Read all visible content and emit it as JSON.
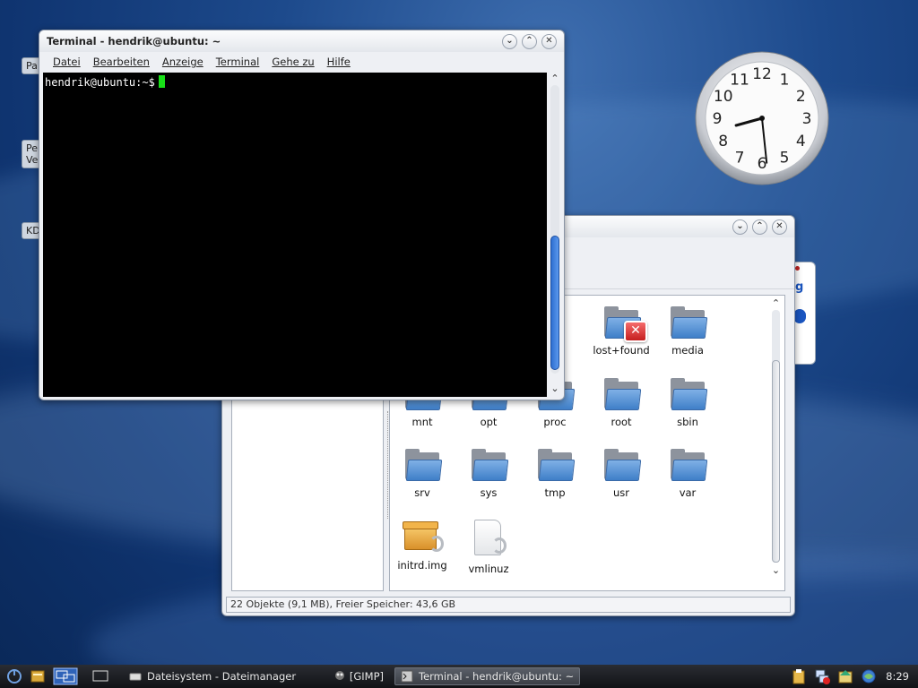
{
  "desktop": {
    "icon_labels": [
      "Pa",
      "Per\nVer",
      "KD"
    ],
    "clock_widget": {
      "hour": 8,
      "minute": 29,
      "numerals": [
        "12",
        "1",
        "2",
        "3",
        "4",
        "5",
        "6",
        "7",
        "8",
        "9",
        "10",
        "11"
      ]
    }
  },
  "terminal": {
    "title": "Terminal - hendrik@ubuntu: ~",
    "menu": [
      "Datei",
      "Bearbeiten",
      "Anzeige",
      "Terminal",
      "Gehe zu",
      "Hilfe"
    ],
    "prompt": "hendrik@ubuntu:~$"
  },
  "file_manager": {
    "status": "22 Objekte (9,1 MB), Freier Speicher: 43,6 GB",
    "items": [
      {
        "name": "lost+found",
        "type": "folder-error"
      },
      {
        "name": "media",
        "type": "folder"
      },
      {
        "name": "mnt",
        "type": "folder"
      },
      {
        "name": "opt",
        "type": "folder"
      },
      {
        "name": "proc",
        "type": "folder"
      },
      {
        "name": "root",
        "type": "folder"
      },
      {
        "name": "sbin",
        "type": "folder"
      },
      {
        "name": "srv",
        "type": "folder"
      },
      {
        "name": "sys",
        "type": "folder"
      },
      {
        "name": "tmp",
        "type": "folder"
      },
      {
        "name": "usr",
        "type": "folder"
      },
      {
        "name": "var",
        "type": "folder"
      },
      {
        "name": "initrd.img",
        "type": "package-link"
      },
      {
        "name": "vmlinuz",
        "type": "file-link"
      }
    ]
  },
  "taskbar": {
    "tasks": [
      {
        "label": "Dateisystem - Dateimanager",
        "active": false
      },
      {
        "label": "[GIMP]",
        "active": false
      },
      {
        "label": "Terminal - hendrik@ubuntu: ~",
        "active": true
      }
    ],
    "time": "8:29"
  },
  "colors": {
    "terminal_cursor": "#18e018",
    "desktop_bg": "#1d4a8c"
  }
}
